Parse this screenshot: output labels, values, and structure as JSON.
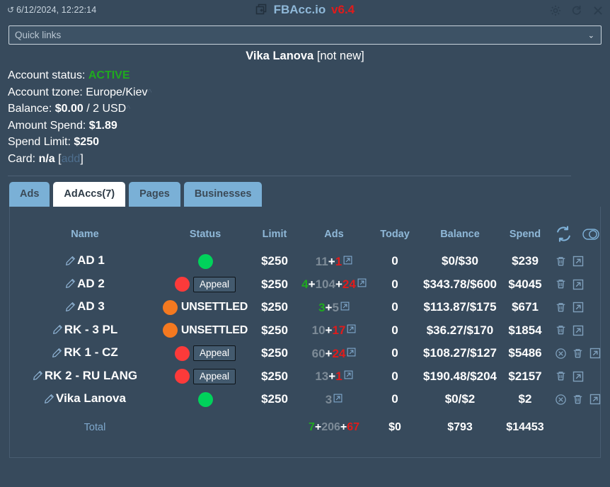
{
  "titlebar": {
    "clock": "6/12/2024, 12:22:14",
    "clock_icon": "rotate-icon",
    "app_name": "FBAcc.io",
    "app_version": "v6.4",
    "logo_icon": "add-window-icon",
    "settings_icon": "gear-icon",
    "refresh_icon": "refresh-icon",
    "close_icon": "close-icon"
  },
  "quick_links": {
    "placeholder": "Quick links",
    "value": "Quick links",
    "chevron": "⌄"
  },
  "account": {
    "name": "Vika Lanova",
    "new_flag": "[not new]",
    "status_label": "Account status:",
    "status_value": "ACTIVE",
    "tzone_label": "Account tzone:",
    "tzone_value": "Europe/Kiev",
    "balance_label": "Balance:",
    "balance_value": "$0.00",
    "balance_rest": "/ 2 USD",
    "spend_label": "Amount Spend:",
    "spend_value": "$1.89",
    "limit_label": "Spend Limit:",
    "limit_value": "$250",
    "card_label": "Card:",
    "card_value": "n/a",
    "card_add": "add",
    "caret": "^"
  },
  "tabs": [
    {
      "label": "Ads",
      "active": false
    },
    {
      "label": "AdAccs(7)",
      "active": true
    },
    {
      "label": "Pages",
      "active": false
    },
    {
      "label": "Businesses",
      "active": false
    }
  ],
  "table": {
    "headers": {
      "name": "Name",
      "status": "Status",
      "limit": "Limit",
      "ads": "Ads",
      "today": "Today",
      "balance": "Balance",
      "spend": "Spend"
    },
    "header_icons": [
      {
        "name": "sync-icon"
      },
      {
        "name": "toggle-switch-icon"
      }
    ],
    "rows": [
      {
        "name": "AD 1",
        "dot": "green",
        "status_text": "",
        "appeal": false,
        "limit": "$250",
        "ads_a": "11",
        "ads_a_color": "grey",
        "ads_b": "1",
        "ads_b_color": "red",
        "ads_c": "",
        "ads_c_color": "",
        "today": "0",
        "balance": "$0/$30",
        "spend": "$239",
        "actions": [
          "trash-icon",
          "external-link-icon"
        ]
      },
      {
        "name": "AD 2",
        "dot": "red",
        "status_text": "",
        "appeal": true,
        "appeal_label": "Appeal",
        "limit": "$250",
        "ads_a": "4",
        "ads_a_color": "green",
        "ads_b": "104",
        "ads_b_color": "grey",
        "ads_c": "24",
        "ads_c_color": "red",
        "today": "0",
        "balance": "$343.78/$600",
        "spend": "$4045",
        "actions": [
          "trash-icon",
          "external-link-icon"
        ]
      },
      {
        "name": "AD 3",
        "dot": "orange",
        "status_text": "UNSETTLED",
        "appeal": false,
        "limit": "$250",
        "ads_a": "3",
        "ads_a_color": "green",
        "ads_b": "5",
        "ads_b_color": "grey",
        "ads_c": "",
        "ads_c_color": "",
        "today": "0",
        "balance": "$113.87/$175",
        "spend": "$671",
        "actions": [
          "trash-icon",
          "external-link-icon"
        ]
      },
      {
        "name": "RK - 3 PL",
        "dot": "orange",
        "status_text": "UNSETTLED",
        "appeal": false,
        "limit": "$250",
        "ads_a": "10",
        "ads_a_color": "grey",
        "ads_b": "17",
        "ads_b_color": "red",
        "ads_c": "",
        "ads_c_color": "",
        "today": "0",
        "balance": "$36.27/$170",
        "spend": "$1854",
        "actions": [
          "trash-icon",
          "external-link-icon"
        ]
      },
      {
        "name": "RK 1 - CZ",
        "dot": "red",
        "status_text": "",
        "appeal": true,
        "appeal_label": "Appeal",
        "limit": "$250",
        "ads_a": "60",
        "ads_a_color": "grey",
        "ads_b": "24",
        "ads_b_color": "red",
        "ads_c": "",
        "ads_c_color": "",
        "today": "0",
        "balance": "$108.27/$127",
        "spend": "$5486",
        "actions": [
          "circle-x-icon",
          "trash-icon",
          "external-link-icon"
        ]
      },
      {
        "name": "RK 2 - RU LANG",
        "dot": "red",
        "status_text": "",
        "appeal": true,
        "appeal_label": "Appeal",
        "limit": "$250",
        "ads_a": "13",
        "ads_a_color": "grey",
        "ads_b": "1",
        "ads_b_color": "red",
        "ads_c": "",
        "ads_c_color": "",
        "today": "0",
        "balance": "$190.48/$204",
        "spend": "$2157",
        "actions": [
          "trash-icon",
          "external-link-icon"
        ]
      },
      {
        "name": "Vika Lanova",
        "dot": "green",
        "status_text": "",
        "appeal": false,
        "limit": "$250",
        "ads_a": "3",
        "ads_a_color": "grey",
        "ads_b": "",
        "ads_b_color": "",
        "ads_c": "",
        "ads_c_color": "",
        "today": "0",
        "balance": "$0/$2",
        "spend": "$2",
        "actions": [
          "circle-x-icon",
          "trash-icon",
          "external-link-icon"
        ]
      }
    ],
    "total": {
      "label": "Total",
      "ads_a": "7",
      "ads_a_color": "green",
      "ads_b": "206",
      "ads_b_color": "grey",
      "ads_c": "67",
      "ads_c_color": "red",
      "today": "$0",
      "balance": "$793",
      "spend": "$14453"
    }
  },
  "colors": {
    "background": "#374a5c",
    "accent": "#7ab0d6",
    "green": "#00d25b",
    "red": "#fc3a3a",
    "orange": "#f47920",
    "text_green": "#1faa1f",
    "text_red": "#e01b1b",
    "muted": "#7d8b97"
  }
}
